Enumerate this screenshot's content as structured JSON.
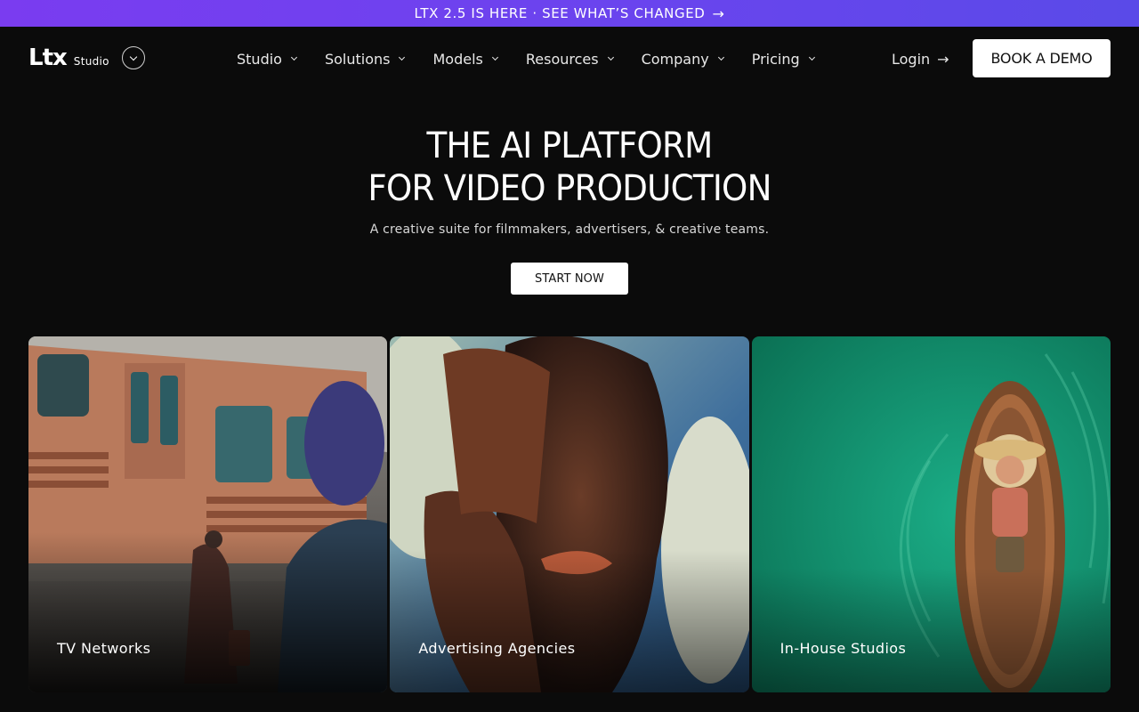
{
  "announcement": {
    "text": "LTX 2.5 IS HERE · SEE WHAT’S CHANGED"
  },
  "brand": {
    "logo": "Ltx",
    "sub": "Studio"
  },
  "nav": {
    "items": [
      {
        "label": "Studio"
      },
      {
        "label": "Solutions"
      },
      {
        "label": "Models"
      },
      {
        "label": "Resources"
      },
      {
        "label": "Company"
      },
      {
        "label": "Pricing"
      }
    ],
    "login_label": "Login",
    "book_demo_label": "BOOK A DEMO"
  },
  "hero": {
    "title_line1": "THE AI PLATFORM",
    "title_line2": "FOR VIDEO PRODUCTION",
    "subtitle": "A creative suite for filmmakers, advertisers, & creative teams.",
    "cta_label": "START NOW"
  },
  "cards": [
    {
      "label": "TV Networks"
    },
    {
      "label": "Advertising Agencies"
    },
    {
      "label": "In-House Studios"
    }
  ],
  "colors": {
    "announce_start": "#7a3cf0",
    "announce_end": "#5a4ae8",
    "background": "#0b0b0b",
    "button_bg": "#ffffff"
  }
}
